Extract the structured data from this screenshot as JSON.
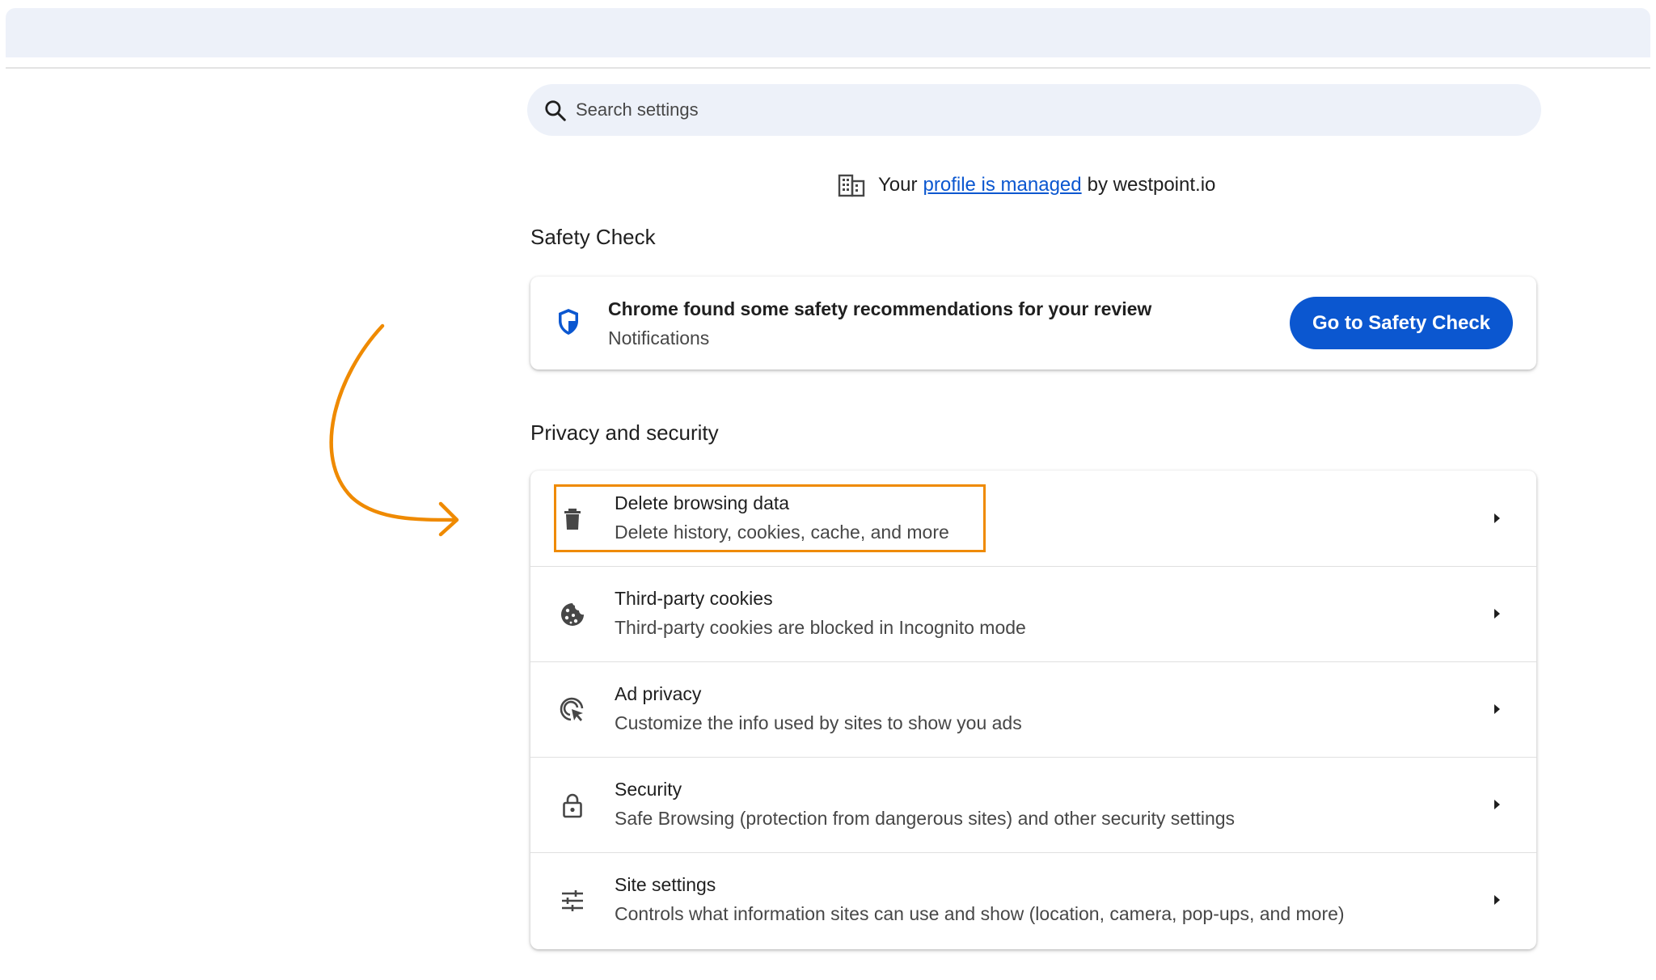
{
  "search": {
    "placeholder": "Search settings",
    "icon": "search-icon"
  },
  "managed": {
    "prefix": "Your",
    "link": "profile is managed",
    "suffix": "by westpoint.io",
    "icon": "building-icon"
  },
  "safety_check": {
    "section_title": "Safety Check",
    "title": "Chrome found some safety recommendations for your review",
    "subtitle": "Notifications",
    "button_label": "Go to Safety Check",
    "icon": "shield-icon"
  },
  "privacy": {
    "section_title": "Privacy and security",
    "items": [
      {
        "title": "Delete browsing data",
        "subtitle": "Delete history, cookies, cache, and more",
        "icon": "trash-icon"
      },
      {
        "title": "Third-party cookies",
        "subtitle": "Third-party cookies are blocked in Incognito mode",
        "icon": "cookie-icon"
      },
      {
        "title": "Ad privacy",
        "subtitle": "Customize the info used by sites to show you ads",
        "icon": "ad-privacy-icon"
      },
      {
        "title": "Security",
        "subtitle": "Safe Browsing (protection from dangerous sites) and other security settings",
        "icon": "lock-icon"
      },
      {
        "title": "Site settings",
        "subtitle": "Controls what information sites can use and show (location, camera, pop-ups, and more)",
        "icon": "sliders-icon"
      }
    ]
  },
  "colors": {
    "accent": "#0b57d0",
    "annotation": "#ef8a00",
    "search_bg": "#edf1f9"
  }
}
